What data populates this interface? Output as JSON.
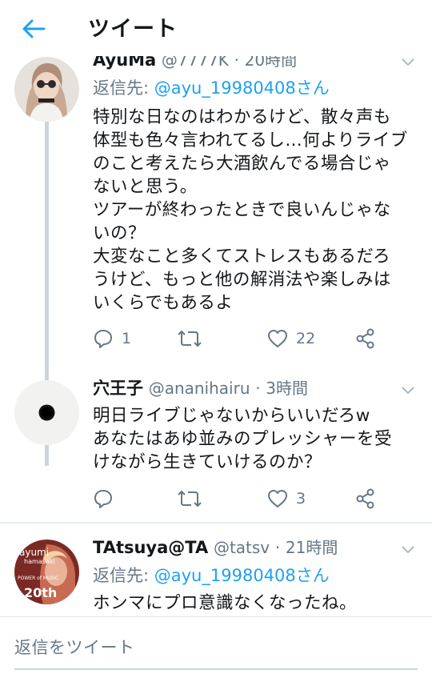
{
  "header": {
    "title": "ツイート",
    "back_icon": "arrow-left-icon",
    "accent": "#1da1f2"
  },
  "tweets": [
    {
      "name": "AyuMa",
      "handle": "@7777K",
      "time": "20時間",
      "reply_label": "返信先:",
      "reply_mention": "@ayu_19980408さん",
      "text_lines": [
        "特別な日なのはわかるけど、散々声も",
        "体型も色々言われてるし…何よりライブ",
        "のこと考えたら大酒飲んでる場合じゃ",
        "ないと思う。",
        "ツアーが終わったときで良いんじゃな",
        "いの？",
        "大変なこと多くてストレスもあるだろ",
        "うけど、もっと他の解消法や楽しみは",
        "いくらでもあるよ"
      ],
      "replies": "1",
      "retweets": "",
      "likes": "22"
    },
    {
      "name": "穴王子",
      "handle": "@ananihairu",
      "dot": "·",
      "time": "3時間",
      "text_lines": [
        "明日ライブじゃないからいいだろw",
        "あなたはあゆ並みのプレッシャーを受",
        "けながら生きていけるのか？"
      ],
      "replies": "",
      "retweets": "",
      "likes": "3"
    },
    {
      "name": "TAtsuya@TA",
      "handle": "@tatsv",
      "dot": "·",
      "time": "21時間",
      "reply_label": "返信先:",
      "reply_mention": "@ayu_19980408さん",
      "text_lines": [
        "ホンマにプロ意識なくなったね。"
      ],
      "avatar_text": [
        "ayumi",
        "hamasaki",
        "POWER of MUSIC",
        "20th"
      ]
    }
  ],
  "compose": {
    "placeholder": "返信をツイート"
  },
  "colors": {
    "text": "#14171a",
    "secondary": "#657786",
    "link": "#1da1f2",
    "divider": "#e6ecf0"
  }
}
